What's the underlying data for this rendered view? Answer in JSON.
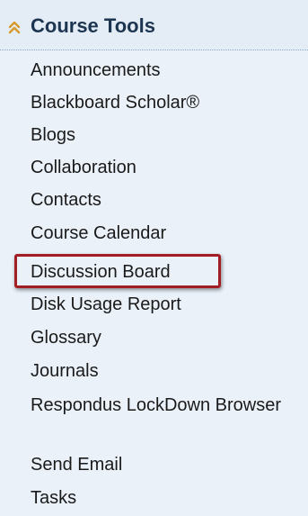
{
  "header": {
    "title": "Course Tools",
    "icon": "double-chevron-up-icon",
    "icon_color": "#d89a2c"
  },
  "menu": {
    "items": [
      {
        "label": "Announcements"
      },
      {
        "label": "Blackboard Scholar®"
      },
      {
        "label": "Blogs"
      },
      {
        "label": "Collaboration"
      },
      {
        "label": "Contacts"
      },
      {
        "label": "Course Calendar"
      },
      {
        "label": "Discussion Board",
        "highlighted": true
      },
      {
        "label": "Disk Usage Report"
      },
      {
        "label": "Glossary"
      },
      {
        "label": "Journals"
      },
      {
        "label": "Respondus LockDown Browser"
      },
      {
        "label": "Send Email"
      },
      {
        "label": "Tasks"
      }
    ]
  },
  "highlight_color": "#a31d24"
}
